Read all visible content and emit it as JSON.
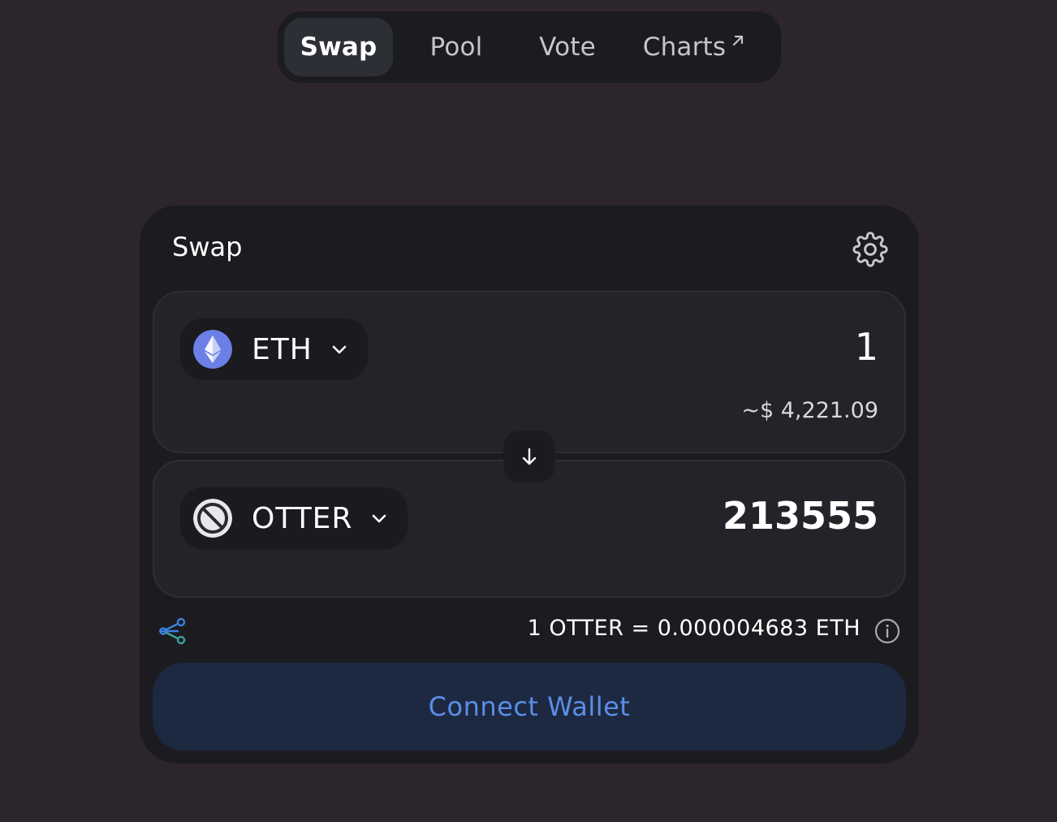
{
  "nav": {
    "tabs": [
      {
        "label": "Swap",
        "active": true
      },
      {
        "label": "Pool",
        "active": false
      },
      {
        "label": "Vote",
        "active": false
      },
      {
        "label": "Charts",
        "active": false,
        "external": true
      }
    ]
  },
  "card": {
    "title": "Swap",
    "settings_icon": "gear-icon"
  },
  "from": {
    "token": "ETH",
    "token_icon": "ethereum-icon",
    "amount": "1",
    "usd_value": "~$ 4,221.09"
  },
  "to": {
    "token": "OTTER",
    "token_icon": "prohibited-token-icon",
    "amount": "213555"
  },
  "rate": {
    "text": "1 OTTER = 0.000004683 ETH"
  },
  "connect_button": {
    "label": "Connect Wallet"
  },
  "colors": {
    "background": "#2c252d",
    "card": "#1c1c20",
    "panel": "#23242a",
    "accent": "#5b8ee8",
    "eth": "#6b7fe6",
    "connect_bg": "#1d2941"
  }
}
